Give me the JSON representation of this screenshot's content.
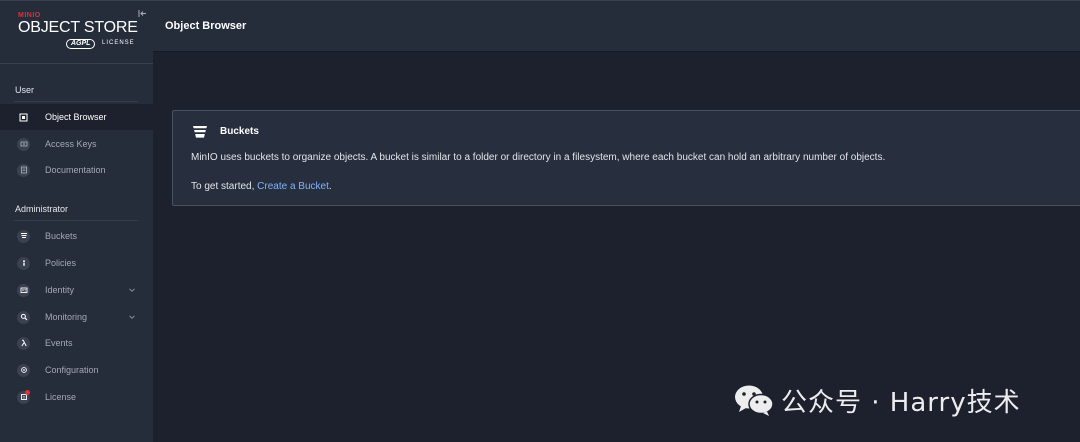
{
  "logo": {
    "brand": "MINIO",
    "title": "OBJECT STORE",
    "edition": "AGPL",
    "license_text": "LICENSE"
  },
  "sidebar": {
    "user_section": "User",
    "admin_section": "Administrator",
    "user_items": [
      {
        "label": "Object Browser",
        "icon": "object-browser-icon",
        "active": true
      },
      {
        "label": "Access Keys",
        "icon": "key-icon",
        "active": false
      },
      {
        "label": "Documentation",
        "icon": "document-icon",
        "active": false
      }
    ],
    "admin_items": [
      {
        "label": "Buckets",
        "icon": "bucket-icon"
      },
      {
        "label": "Policies",
        "icon": "policy-icon"
      },
      {
        "label": "Identity",
        "icon": "identity-icon",
        "has_chevron": true
      },
      {
        "label": "Monitoring",
        "icon": "monitoring-icon",
        "has_chevron": true
      },
      {
        "label": "Events",
        "icon": "lambda-icon"
      },
      {
        "label": "Configuration",
        "icon": "gear-icon"
      },
      {
        "label": "License",
        "icon": "license-icon",
        "has_badge": true
      }
    ]
  },
  "header": {
    "title": "Object Browser"
  },
  "card": {
    "title": "Buckets",
    "body": "MinIO uses buckets to organize objects. A bucket is similar to a folder or directory in a filesystem, where each bucket can hold an arbitrary number of objects.",
    "cta_prefix": "To get started, ",
    "cta_link": "Create a Bucket",
    "cta_suffix": "."
  },
  "watermark": {
    "text": "公众号 · Harry技术"
  },
  "colors": {
    "sidebar_bg": "#252c3a",
    "main_bg": "#1c212d",
    "card_bg": "#272e3d",
    "link": "#7fb4ff",
    "brand_red": "#e0313a"
  }
}
